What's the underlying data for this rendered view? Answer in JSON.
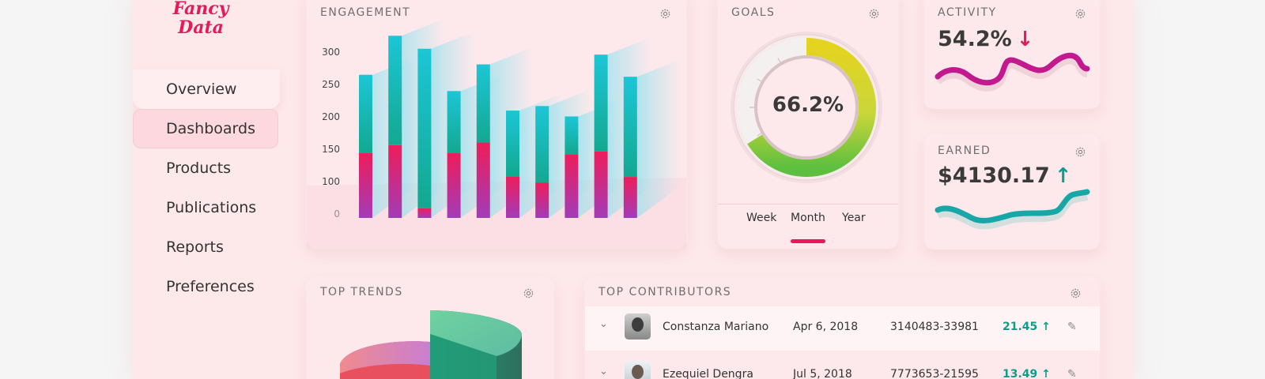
{
  "app": {
    "logo_line1": "Fancy",
    "logo_line2": "Data"
  },
  "sidebar": {
    "items": [
      {
        "label": "Overview"
      },
      {
        "label": "Dashboards"
      },
      {
        "label": "Products"
      },
      {
        "label": "Publications"
      },
      {
        "label": "Reports"
      },
      {
        "label": "Preferences"
      }
    ],
    "active": "Dashboards"
  },
  "engagement": {
    "title": "ENGAGEMENT",
    "icon": "gear-icon"
  },
  "chart_data": {
    "type": "bar",
    "title": "ENGAGEMENT",
    "ylim": [
      0,
      300
    ],
    "yticks": [
      "300",
      "250",
      "200",
      "150",
      "100",
      "0"
    ],
    "series": [
      {
        "name": "",
        "values": [
          100,
          112,
          15,
          100,
          116,
          64,
          54,
          98,
          102,
          63
        ]
      },
      {
        "name": "",
        "values": [
          120,
          168,
          245,
          95,
          120,
          101,
          118,
          58,
          149,
          154
        ]
      }
    ],
    "colors": {
      "bottom": "#e5195c",
      "top": "#19c2cf"
    }
  },
  "goals": {
    "title": "GOALS",
    "percent_label": "66.2%",
    "percent_value": 66.2,
    "tabs": [
      {
        "label": "Week"
      },
      {
        "label": "Month"
      },
      {
        "label": "Year"
      }
    ],
    "active_tab": "Month"
  },
  "activity": {
    "title": "ACTIVITY",
    "value": "54.2%",
    "trend": "↓",
    "trend_color": "#e5195c",
    "line_color": "#c2198e"
  },
  "earned": {
    "title": "EARNED",
    "value": "$4130.17",
    "trend": "↑",
    "trend_color": "#119b8b",
    "line_color": "#18a7a7"
  },
  "trends": {
    "title": "TOP TRENDS"
  },
  "contributors": {
    "title": "TOP CONTRIBUTORS",
    "rows": [
      {
        "name": "Constanza Mariano",
        "date": "Apr 6, 2018",
        "id": "3140483-33981",
        "value": "21.45 ↑"
      },
      {
        "name": "Ezequiel Dengra",
        "date": "Jul 5, 2018",
        "id": "7773653-21595",
        "value": "13.49 ↑"
      }
    ]
  }
}
